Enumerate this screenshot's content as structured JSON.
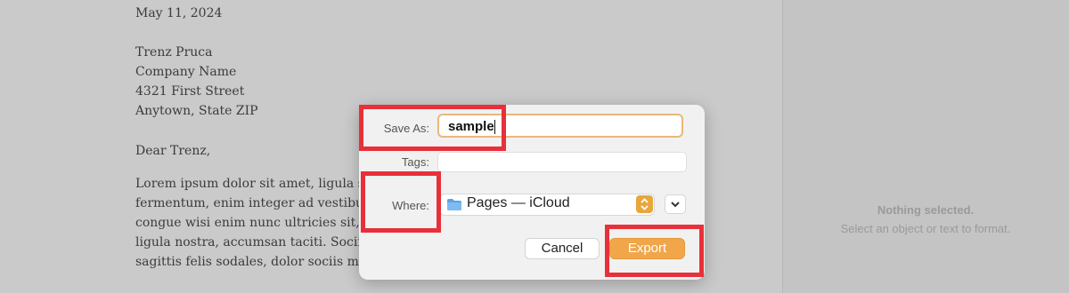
{
  "document": {
    "date": "May 11, 2024",
    "recipient_name": "Trenz Pruca",
    "company": "Company Name",
    "street": "4321 First Street",
    "city": "Anytown, State ZIP",
    "greeting": "Dear Trenz,",
    "body_lines": [
      "Lorem ipsum dolor sit amet, ligula su",
      "fermentum, enim integer ad vestibul",
      "congue wisi enim nunc ultricies sit, m",
      "ligula nostra, accumsan taciti. Sociis m",
      "sagittis felis sodales, dolor sociis maur"
    ]
  },
  "inspector": {
    "icon": "paintbrush-icon",
    "title": "Nothing selected.",
    "subtitle": "Select an object or text to format."
  },
  "dialog": {
    "save_as_label": "Save As:",
    "save_as_value": "sample",
    "tags_label": "Tags:",
    "where_label": "Where:",
    "where_value": "Pages — iCloud",
    "where_icon": "folder-icon",
    "cancel_label": "Cancel",
    "export_label": "Export",
    "accent_color": "#f1a64a"
  },
  "highlight_color": "#e8303a"
}
